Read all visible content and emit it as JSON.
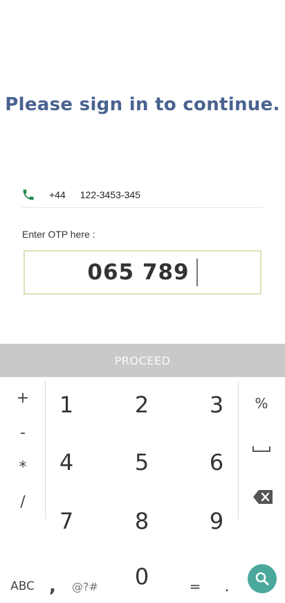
{
  "header": {
    "title": "Please sign in to continue."
  },
  "phone": {
    "icon": "phone-icon",
    "icon_color": "#1e8a4a",
    "country_code": "+44",
    "number": "122-3453-345"
  },
  "otp": {
    "label": "Enter OTP here :",
    "value": "065 789"
  },
  "proceed": {
    "label": "PROCEED",
    "background": "#c9c9c9"
  },
  "keyboard": {
    "left_ops": [
      "+",
      "-",
      "*",
      "/"
    ],
    "digits": [
      "1",
      "2",
      "3",
      "4",
      "5",
      "6",
      "7",
      "8",
      "9",
      "0"
    ],
    "right_ops": {
      "percent": "%",
      "space_icon": "space-icon",
      "backspace_icon": "backspace-icon"
    },
    "bottom": {
      "abc": "ABC",
      "comma": ",",
      "symbols": "@?#",
      "equals": "=",
      "period": "."
    },
    "search_icon": "search-icon",
    "accent": "#4aa89c"
  }
}
